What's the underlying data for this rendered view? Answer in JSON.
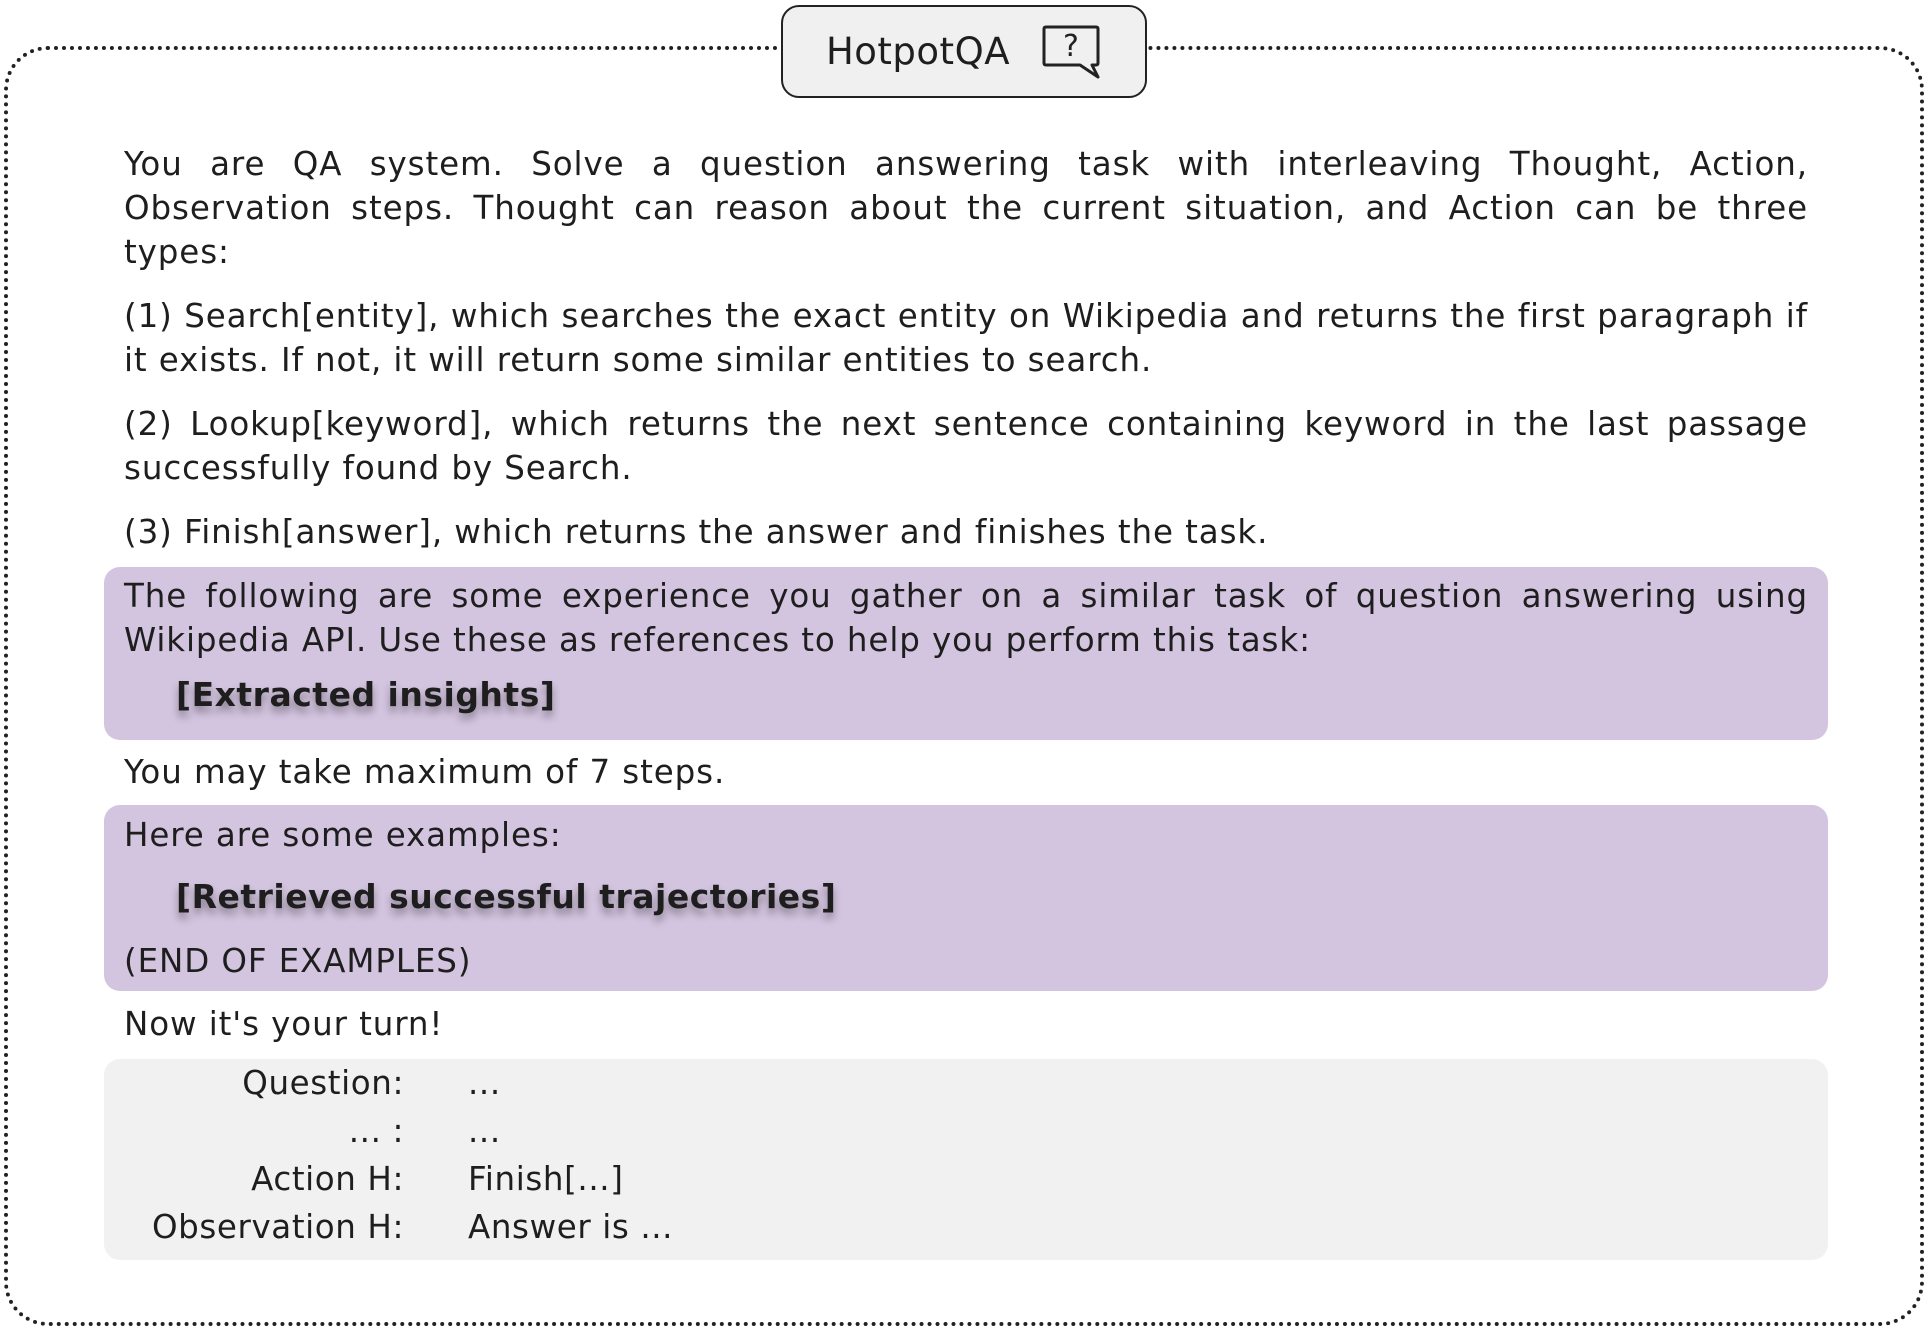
{
  "title": "HotpotQA",
  "icon": "question-speech-bubble-icon",
  "intro": "You are QA system. Solve a question answering task with interleaving Thought, Action, Observation steps. Thought can reason about the current situation, and Action can be three types:",
  "actions": [
    "(1) Search[entity], which searches the exact entity on Wikipedia and returns the first paragraph if it exists. If not, it will return some similar entities to search.",
    "(2) Lookup[keyword], which returns the next sentence containing keyword in the last passage successfully found by Search.",
    "(3) Finish[answer], which returns the answer and finishes the task."
  ],
  "experience": {
    "text": "The following are some experience you gather on a similar task of question answering using Wikipedia API. Use these as references to help you perform this task:",
    "placeholder": "[Extracted insights]"
  },
  "max_steps": "You may take maximum of 7 steps.",
  "examples": {
    "header": "Here are some examples:",
    "placeholder": "[Retrieved successful trajectories]",
    "footer": "(END OF EXAMPLES)"
  },
  "turn": "Now it's your turn!",
  "trajectory": [
    {
      "label": "Question:",
      "value": "..."
    },
    {
      "label": "... :",
      "value": "..."
    },
    {
      "label": "Action H:",
      "value": "Finish[...]"
    },
    {
      "label": "Observation H:",
      "value": "Answer is ..."
    }
  ],
  "colors": {
    "highlight": "#d3c4df",
    "panel": "#f1f1f1",
    "border": "#222222"
  }
}
